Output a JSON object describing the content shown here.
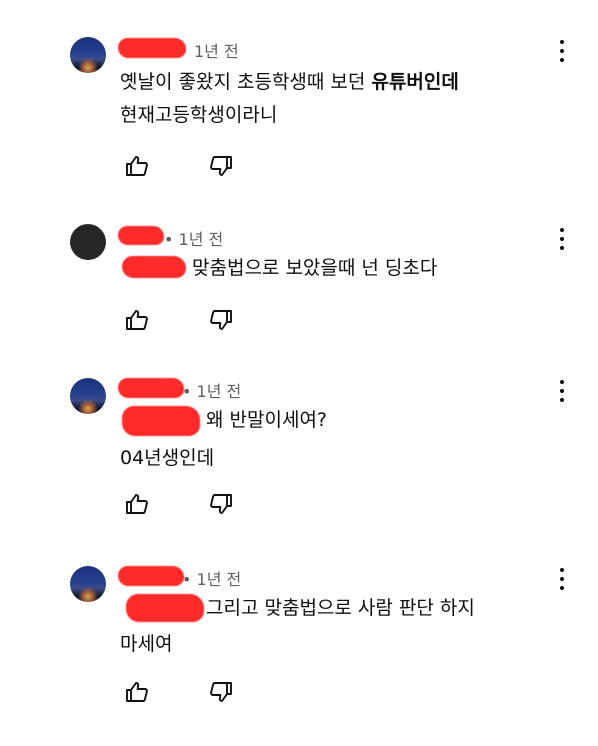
{
  "comments": [
    {
      "avatar": "night-sky-avatar",
      "time": "1년 전",
      "text_line1_normal": "옛날이 좋왔지 초등학생때 보던 ",
      "text_line1_bold": "유튜버인데",
      "text_line2": "현재고등학생이라니",
      "like_icon": "thumbs-up-icon",
      "dislike_icon": "thumbs-down-icon",
      "menu_icon": "more-vertical-icon"
    },
    {
      "avatar": "dark-circle-avatar",
      "time": "• 1년 전",
      "text_line1": "맞춤법으로 보았을때 넌 딩초다",
      "like_icon": "thumbs-up-icon",
      "dislike_icon": "thumbs-down-icon",
      "menu_icon": "more-vertical-icon"
    },
    {
      "avatar": "night-sky-avatar",
      "time": "• 1년 전",
      "text_line1": "왜 반말이세여?",
      "text_line2": "04년생인데",
      "like_icon": "thumbs-up-icon",
      "dislike_icon": "thumbs-down-icon",
      "menu_icon": "more-vertical-icon"
    },
    {
      "avatar": "night-sky-avatar",
      "time": "• 1년 전",
      "text_line1": "그리고 맞춤법으로 사람 판단 하지",
      "text_line2": "마세여",
      "like_icon": "thumbs-up-icon",
      "dislike_icon": "thumbs-down-icon",
      "menu_icon": "more-vertical-icon"
    }
  ],
  "colors": {
    "redaction": "#ff2a2a",
    "text": "#0f0f0f",
    "meta": "#606060"
  }
}
